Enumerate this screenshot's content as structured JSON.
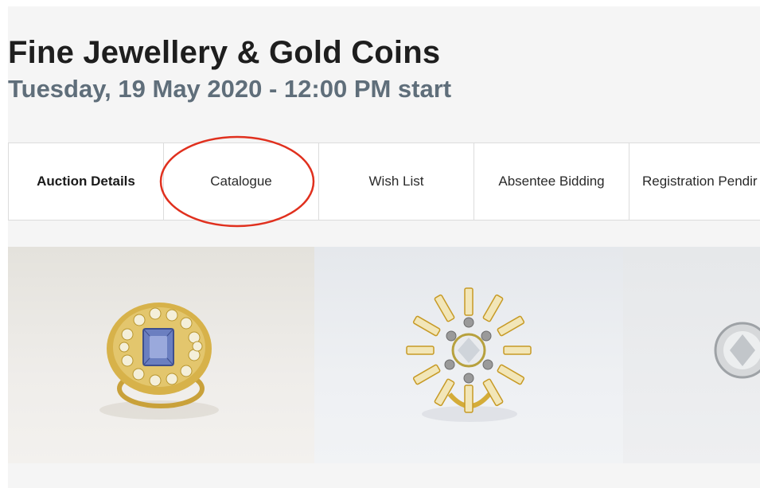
{
  "auction": {
    "title": "Fine Jewellery & Gold Coins",
    "subtitle": "Tuesday, 19 May 2020 - 12:00 PM start"
  },
  "tabs": [
    {
      "label": "Auction Details",
      "active": true
    },
    {
      "label": "Catalogue",
      "active": false,
      "highlighted": true
    },
    {
      "label": "Wish List",
      "active": false
    },
    {
      "label": "Absentee Bidding",
      "active": false
    },
    {
      "label": "Registration Pendir",
      "active": false
    }
  ],
  "gallery": {
    "lots": [
      {
        "image": "sapphire-diamond-gold-ring"
      },
      {
        "image": "diamond-cluster-gold-ring"
      },
      {
        "image": "diamond-stud-earring"
      }
    ]
  },
  "colors": {
    "title": "#1e1e1e",
    "subtitle": "#5f6e7a",
    "highlight_ring": "#e0301e",
    "panel_background": "#f5f5f5"
  }
}
